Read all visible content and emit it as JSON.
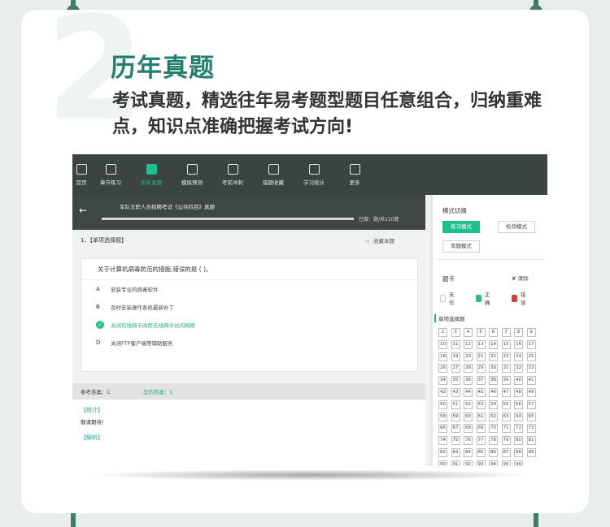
{
  "promo": {
    "headline": "历年真题",
    "subline": "考试真题，精选往年易考题型题目任意组合，归纳重难点，知识点准确把握考试方向!",
    "big_number": "2"
  },
  "nav": [
    {
      "label": "首页",
      "icon": "home-icon"
    },
    {
      "label": "章节练习",
      "icon": "edit-icon"
    },
    {
      "label": "历年真题",
      "icon": "document-icon",
      "active": true
    },
    {
      "label": "模拟预测",
      "icon": "clock-icon"
    },
    {
      "label": "考前冲刺",
      "icon": "book-icon"
    },
    {
      "label": "错题收藏",
      "icon": "star-icon"
    },
    {
      "label": "学习统计",
      "icon": "chart-icon"
    },
    {
      "label": "更多",
      "icon": "grid-icon"
    }
  ],
  "exam": {
    "title": "军队文职人员招聘考试《公共科目》真题",
    "progress_fraction": 0.0,
    "done_text": "已做：题/共110题"
  },
  "question": {
    "type_label": "1、【单项选择题】",
    "favorite_label": "收藏本题",
    "stem": "关于计算机病毒防范的措施,错误的是 ( )。",
    "options": [
      {
        "key": "A",
        "text": "安装专业的病毒软件",
        "correct": false
      },
      {
        "key": "B",
        "text": "及时安装操作系统最新补丁",
        "correct": false
      },
      {
        "key": "C",
        "text": "关闭有线网卡改用无线网卡访问网络",
        "correct": true
      },
      {
        "key": "D",
        "text": "关闭FTP客户端等辅助服务",
        "correct": false
      }
    ],
    "reference_answer": "参考答案：C",
    "your_answer": "您的答案：C",
    "stats_tag": "【统计】",
    "stats_text": "敬请期待！",
    "analysis_tag": "【解析】"
  },
  "sidebar": {
    "mode_title": "模式切换",
    "modes": [
      {
        "label": "练习模式",
        "active": true
      },
      {
        "label": "检测模式",
        "active": false
      },
      {
        "label": "背题模式",
        "active": false
      }
    ],
    "card_title": "题卡",
    "clear_label": "清除",
    "legend": [
      {
        "label": "未作",
        "color": "#ffffff"
      },
      {
        "label": "正确",
        "color": "#1fbf8d"
      },
      {
        "label": "错误",
        "color": "#e53935"
      }
    ],
    "section_label": "单项选择题",
    "answered": [
      1
    ],
    "total_cells": 96
  },
  "colors": {
    "accent": "#1fbf8d",
    "headline": "#237f6b",
    "nav_bg": "#3b4442"
  }
}
